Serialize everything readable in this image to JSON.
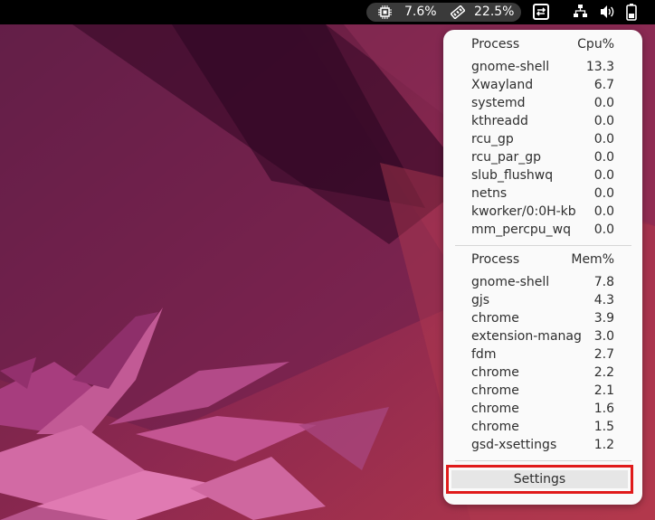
{
  "topbar": {
    "cpu_percent": "7.6%",
    "mem_percent": "22.5%",
    "icons": [
      "cpu-icon",
      "memory-icon",
      "system-monitor-icon",
      "network-icon",
      "volume-icon",
      "battery-icon"
    ]
  },
  "cpu_section": {
    "header_process": "Process",
    "header_value": "Cpu%",
    "rows": [
      {
        "name": "gnome-shell",
        "value": "13.3"
      },
      {
        "name": "Xwayland",
        "value": "6.7"
      },
      {
        "name": "systemd",
        "value": "0.0"
      },
      {
        "name": "kthreadd",
        "value": "0.0"
      },
      {
        "name": "rcu_gp",
        "value": "0.0"
      },
      {
        "name": "rcu_par_gp",
        "value": "0.0"
      },
      {
        "name": "slub_flushwq",
        "value": "0.0"
      },
      {
        "name": "netns",
        "value": "0.0"
      },
      {
        "name": "kworker/0:0H-kb",
        "value": "0.0"
      },
      {
        "name": "mm_percpu_wq",
        "value": "0.0"
      }
    ]
  },
  "mem_section": {
    "header_process": "Process",
    "header_value": "Mem%",
    "rows": [
      {
        "name": "gnome-shell",
        "value": "7.8"
      },
      {
        "name": "gjs",
        "value": "4.3"
      },
      {
        "name": "chrome",
        "value": "3.9"
      },
      {
        "name": "extension-manag",
        "value": "3.0"
      },
      {
        "name": "fdm",
        "value": "2.7"
      },
      {
        "name": "chrome",
        "value": "2.2"
      },
      {
        "name": "chrome",
        "value": "2.1"
      },
      {
        "name": "chrome",
        "value": "1.6"
      },
      {
        "name": "chrome",
        "value": "1.5"
      },
      {
        "name": "gsd-xsettings",
        "value": "1.2"
      }
    ]
  },
  "settings_label": "Settings",
  "colors": {
    "highlight": "#e01b1b",
    "popup_bg": "#fafafa",
    "topbar_bg": "#000000"
  }
}
